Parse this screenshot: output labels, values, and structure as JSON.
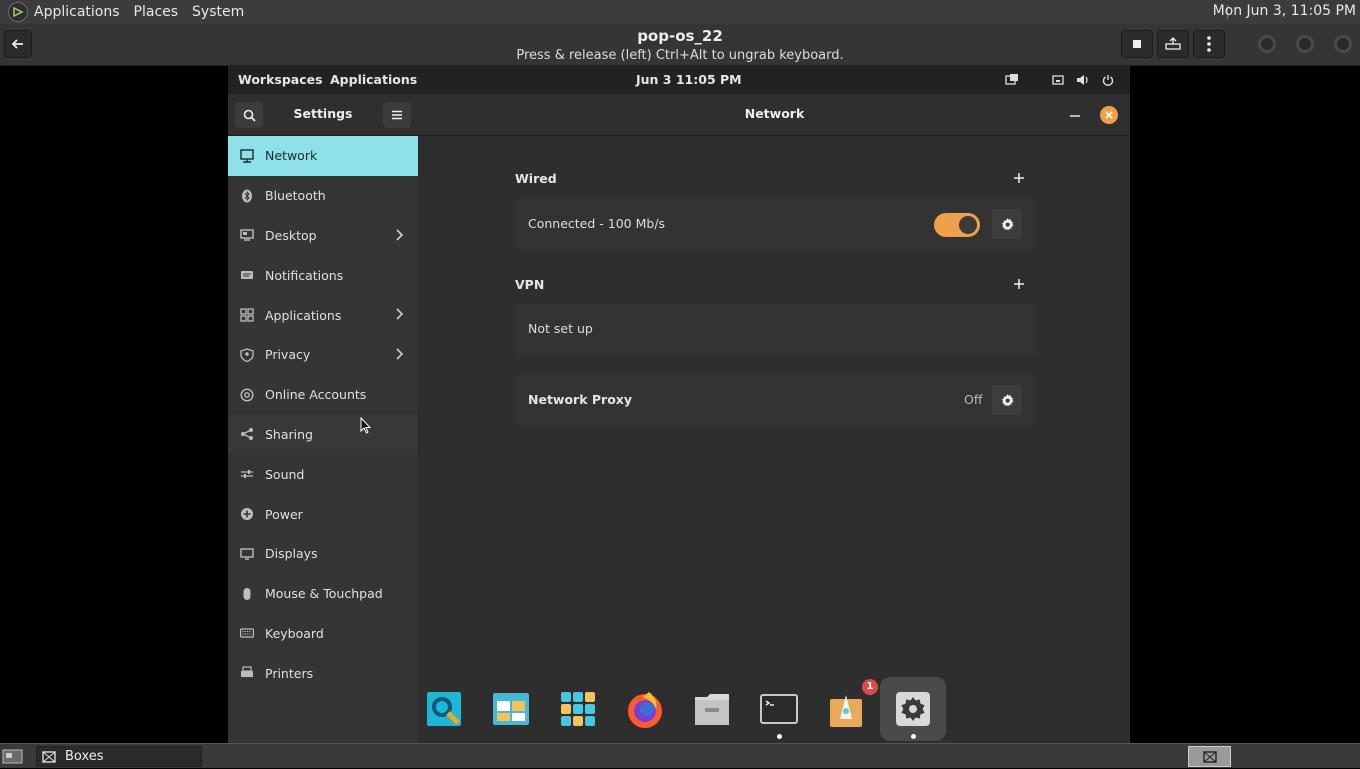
{
  "host_panel": {
    "menus": [
      "Applications",
      "Places",
      "System"
    ],
    "clock": "Mon Jun  3, 11:05 PM"
  },
  "boxes": {
    "title": "pop-os_22",
    "subtitle": "Press & release (left) Ctrl+Alt to ungrab keyboard."
  },
  "guest_panel": {
    "workspaces": "Workspaces",
    "applications": "Applications",
    "clock": "Jun 3  11:05 PM"
  },
  "settings": {
    "title": "Settings",
    "page_title": "Network",
    "sidebar": [
      {
        "label": "Network",
        "icon": "network-icon",
        "active": true,
        "chevron": false
      },
      {
        "label": "Bluetooth",
        "icon": "bluetooth-icon",
        "active": false,
        "chevron": false
      },
      {
        "label": "Desktop",
        "icon": "desktop-icon",
        "active": false,
        "chevron": true
      },
      {
        "label": "Notifications",
        "icon": "notifications-icon",
        "active": false,
        "chevron": false
      },
      {
        "label": "Applications",
        "icon": "applications-icon",
        "active": false,
        "chevron": true
      },
      {
        "label": "Privacy",
        "icon": "privacy-icon",
        "active": false,
        "chevron": true
      },
      {
        "label": "Online Accounts",
        "icon": "at-icon",
        "active": false,
        "chevron": false
      },
      {
        "label": "Sharing",
        "icon": "share-icon",
        "active": false,
        "chevron": false
      },
      {
        "label": "Sound",
        "icon": "sound-icon",
        "active": false,
        "chevron": false
      },
      {
        "label": "Power",
        "icon": "power-icon",
        "active": false,
        "chevron": false
      },
      {
        "label": "Displays",
        "icon": "display-icon",
        "active": false,
        "chevron": false
      },
      {
        "label": "Mouse & Touchpad",
        "icon": "mouse-icon",
        "active": false,
        "chevron": false
      },
      {
        "label": "Keyboard",
        "icon": "keyboard-icon",
        "active": false,
        "chevron": false
      },
      {
        "label": "Printers",
        "icon": "printer-icon",
        "active": false,
        "chevron": false
      }
    ],
    "wired": {
      "label": "Wired",
      "status": "Connected - 100 Mb/s",
      "enabled": true
    },
    "vpn": {
      "label": "VPN",
      "status": "Not set up"
    },
    "proxy": {
      "label": "Network Proxy",
      "value": "Off"
    }
  },
  "dock": {
    "items": [
      "search-app-icon",
      "workspaces-app-icon",
      "app-grid-icon",
      "firefox-icon",
      "files-icon",
      "terminal-icon",
      "pop-shop-icon",
      "settings-app-icon"
    ],
    "pop_shop_badge": "1"
  },
  "host_bottom": {
    "task_label": "Boxes"
  },
  "colors": {
    "accent": "#8ee0eb",
    "toggle": "#f0a04a",
    "close": "#f0a04a"
  }
}
